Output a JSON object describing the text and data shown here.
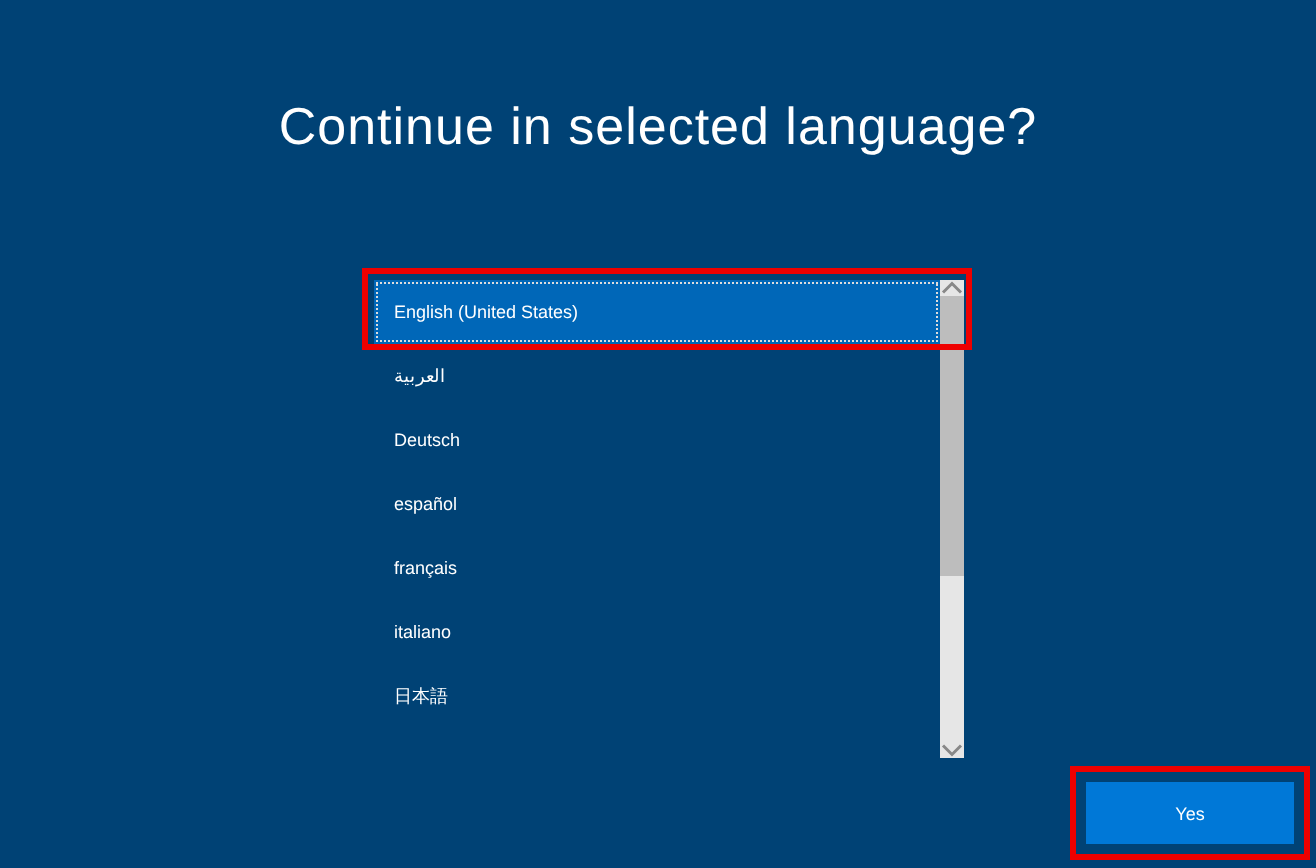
{
  "title": "Continue in selected language?",
  "languages": [
    {
      "label": "English (United States)",
      "selected": true
    },
    {
      "label": "العربية",
      "selected": false
    },
    {
      "label": "Deutsch",
      "selected": false
    },
    {
      "label": "español",
      "selected": false
    },
    {
      "label": "français",
      "selected": false
    },
    {
      "label": "italiano",
      "selected": false
    },
    {
      "label": "日本語",
      "selected": false
    }
  ],
  "button": "Yes"
}
